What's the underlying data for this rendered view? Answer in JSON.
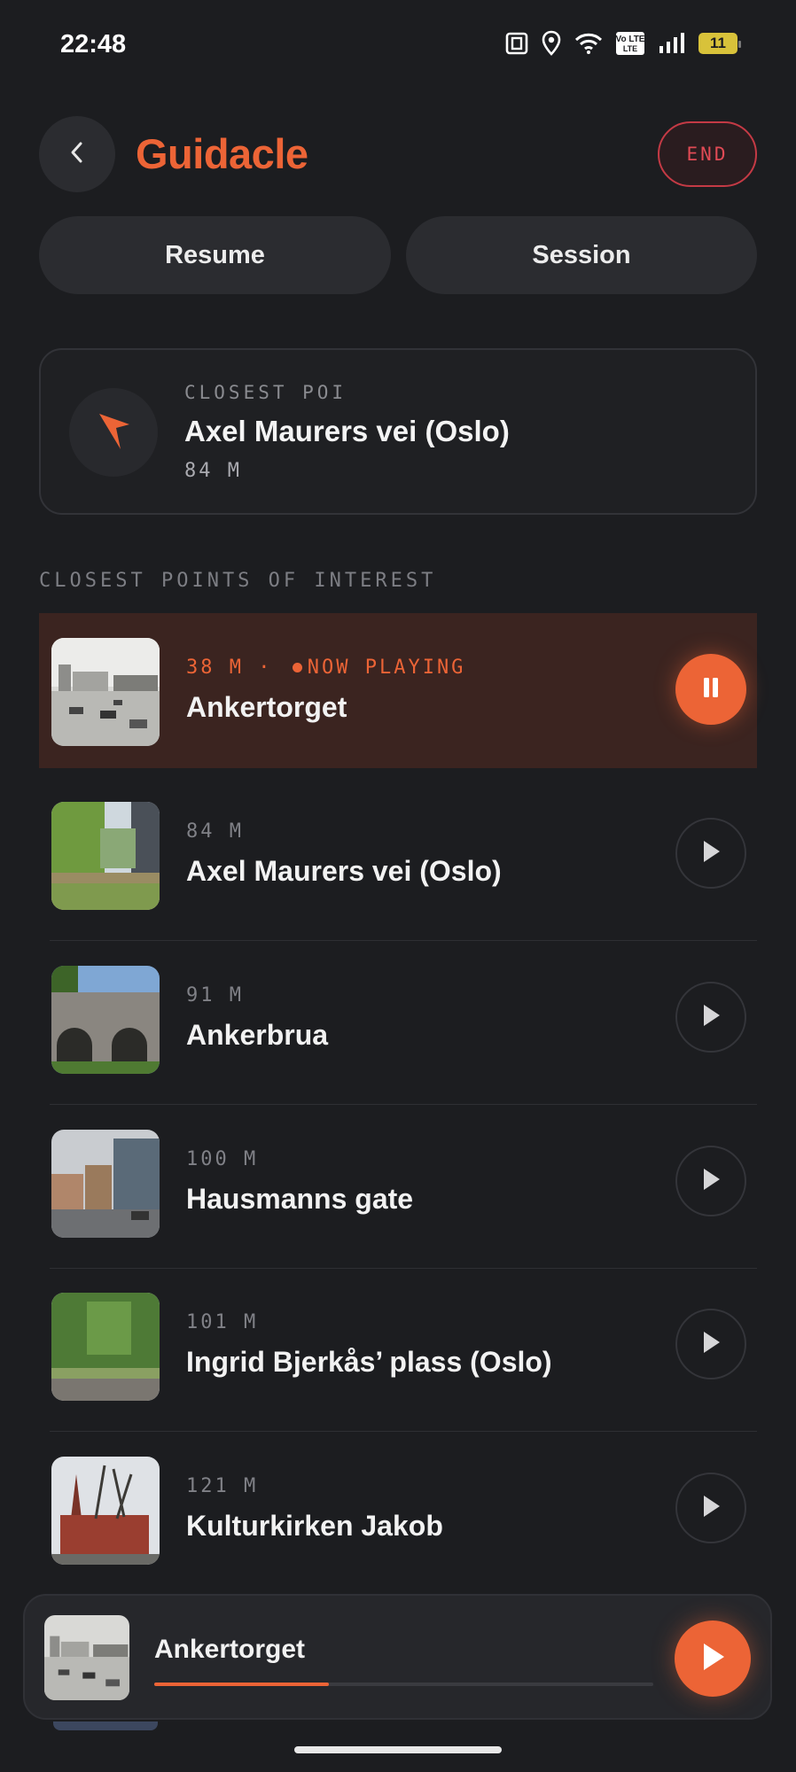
{
  "status_bar": {
    "time": "22:48",
    "network_label": "Vo LTE",
    "battery_level": "11",
    "icons": [
      "nfc-icon",
      "location-icon",
      "wifi-icon",
      "volte-icon",
      "signal-icon",
      "battery-icon"
    ]
  },
  "header": {
    "title": "Guidacle",
    "end_label": "END",
    "back_icon": "chevron-left-icon"
  },
  "controls": {
    "resume_label": "Resume",
    "session_label": "Session"
  },
  "closest_poi": {
    "caption": "CLOSEST POI",
    "name": "Axel Maurers vei (Oslo)",
    "distance": "84 M",
    "icon": "navigation-arrow-icon"
  },
  "list": {
    "section_label": "CLOSEST POINTS OF INTEREST",
    "items": [
      {
        "distance": "38 M",
        "status": "NOW PLAYING",
        "name": "Ankertorget",
        "playing": true
      },
      {
        "distance": "84 M",
        "status": "",
        "name": "Axel Maurers vei (Oslo)",
        "playing": false
      },
      {
        "distance": "91 M",
        "status": "",
        "name": "Ankerbrua",
        "playing": false
      },
      {
        "distance": "100 M",
        "status": "",
        "name": "Hausmanns gate",
        "playing": false
      },
      {
        "distance": "101 M",
        "status": "",
        "name": "Ingrid Bjerkås’ plass (Oslo)",
        "playing": false
      },
      {
        "distance": "121 M",
        "status": "",
        "name": "Kulturkirken Jakob",
        "playing": false
      }
    ]
  },
  "player": {
    "title": "Ankertorget",
    "progress": 0.35,
    "play_icon": "play-icon"
  },
  "colors": {
    "accent": "#ec6436",
    "background": "#1c1d20",
    "danger": "#e04a55",
    "playing_row": "#3b2420"
  }
}
